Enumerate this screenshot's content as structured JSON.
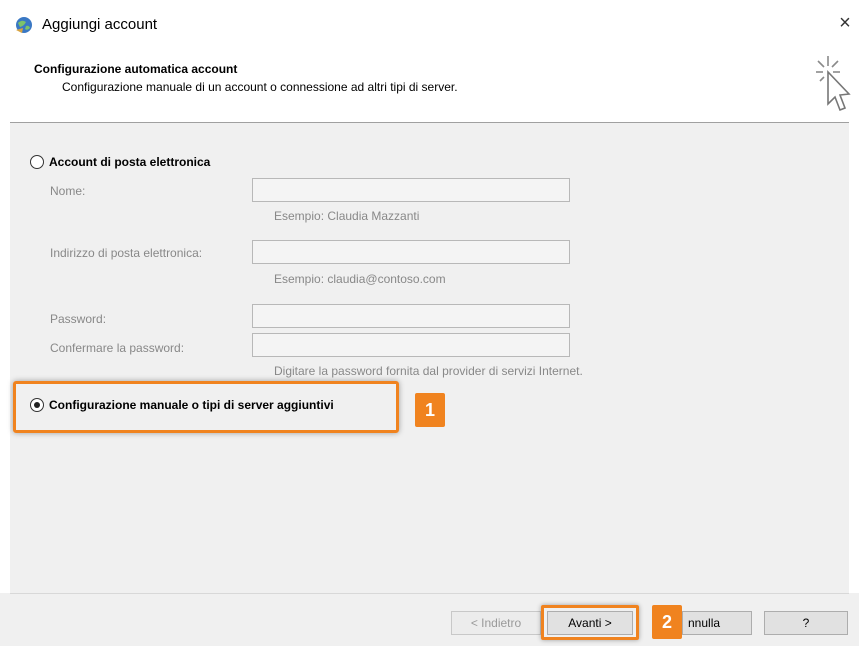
{
  "window": {
    "title": "Aggiungi account",
    "close_label": "×",
    "app_icon": "outlook-globe-icon"
  },
  "header": {
    "title": "Configurazione automatica account",
    "subtitle": "Configurazione manuale di un account o connessione ad altri tipi di server.",
    "icon": "magic-cursor-icon"
  },
  "email_option": {
    "label": "Account di posta elettronica",
    "selected": false
  },
  "fields": {
    "name_label": "Nome:",
    "name_value": "",
    "name_hint": "Esempio: Claudia Mazzanti",
    "email_label": "Indirizzo di posta elettronica:",
    "email_value": "",
    "email_hint": "Esempio: claudia@contoso.com",
    "password_label": "Password:",
    "password_value": "",
    "confirm_label": "Confermare la password:",
    "confirm_value": "",
    "password_hint": "Digitare la password fornita dal provider di servizi Internet."
  },
  "manual_option": {
    "label": "Configurazione manuale o tipi di server aggiuntivi",
    "selected": true
  },
  "callouts": {
    "step1": "1",
    "step2": "2"
  },
  "footer": {
    "back_label": "< Indietro",
    "next_label": "Avanti >",
    "cancel_label": "nnulla",
    "help_label": "?"
  },
  "colors": {
    "accent": "#f0831f",
    "panel": "#f0f0f0"
  }
}
